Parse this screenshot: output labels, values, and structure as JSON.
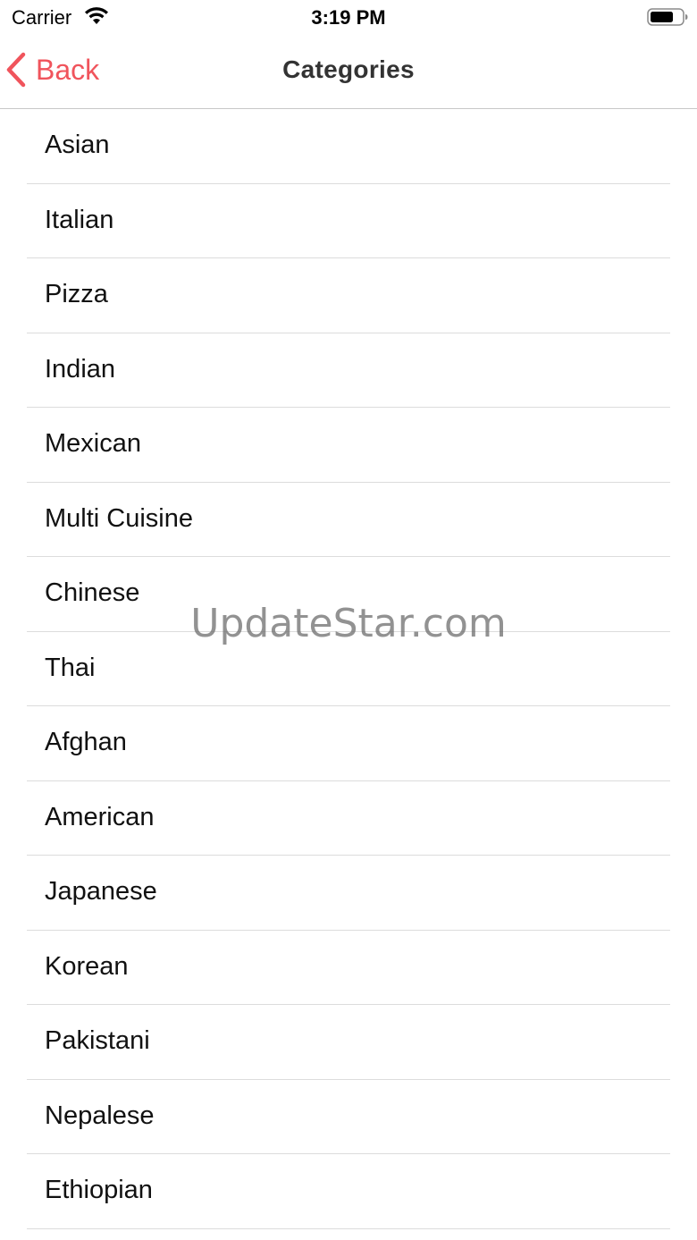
{
  "status_bar": {
    "carrier": "Carrier",
    "time": "3:19 PM",
    "wifi_icon": "wifi-icon",
    "battery_icon": "battery-icon"
  },
  "nav": {
    "back_label": "Back",
    "back_icon": "chevron-left-icon",
    "title": "Categories",
    "accent_color": "#f0545c"
  },
  "categories": [
    {
      "label": "Asian"
    },
    {
      "label": "Italian"
    },
    {
      "label": "Pizza"
    },
    {
      "label": "Indian"
    },
    {
      "label": "Mexican"
    },
    {
      "label": "Multi Cuisine"
    },
    {
      "label": "Chinese"
    },
    {
      "label": "Thai"
    },
    {
      "label": "Afghan"
    },
    {
      "label": "American"
    },
    {
      "label": "Japanese"
    },
    {
      "label": "Korean"
    },
    {
      "label": "Pakistani"
    },
    {
      "label": "Nepalese"
    },
    {
      "label": "Ethiopian"
    }
  ],
  "watermark": "UpdateStar.com"
}
